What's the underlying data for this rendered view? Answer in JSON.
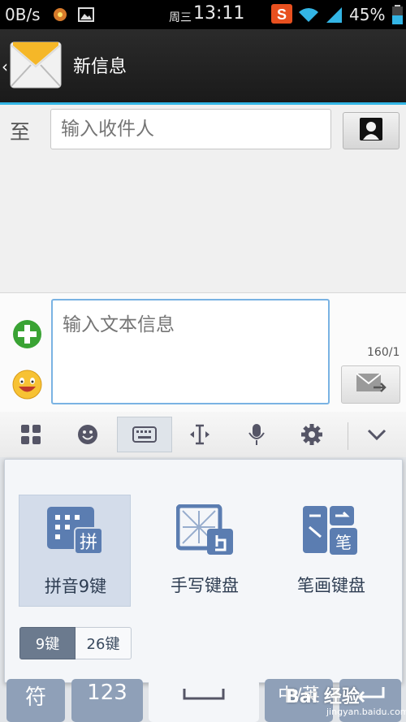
{
  "status_bar": {
    "net_speed": "0B/s",
    "weekday": "周三",
    "time": "13:11",
    "battery": "45%",
    "icons": [
      "gamepad-icon",
      "image-icon",
      "sogou-icon",
      "wifi-icon",
      "signal-icon",
      "battery-icon"
    ]
  },
  "header": {
    "title": "新信息",
    "app_icon": "envelope-icon"
  },
  "recipient": {
    "to_label": "至",
    "placeholder": "输入收件人"
  },
  "compose": {
    "placeholder": "输入文本信息",
    "char_counter": "160/1"
  },
  "ime_toolbar": {
    "items": [
      "grid-menu-icon",
      "emoji-icon",
      "keyboard-icon",
      "cursor-icon",
      "microphone-icon",
      "settings-icon",
      "collapse-chevron-icon"
    ],
    "selected": "keyboard-icon"
  },
  "keyboard_panel": {
    "options": [
      {
        "label": "拼音9键",
        "icon": "pinyin-9-icon",
        "selected": true,
        "badge": "拼"
      },
      {
        "label": "手写键盘",
        "icon": "handwriting-icon",
        "selected": false
      },
      {
        "label": "笔画键盘",
        "icon": "stroke-icon",
        "selected": false,
        "badge": "笔"
      }
    ],
    "layout_toggle": [
      {
        "label": "9键",
        "selected": true
      },
      {
        "label": "26键",
        "selected": false
      }
    ]
  },
  "bottom_keys": [
    "符",
    "123",
    "",
    "中/英"
  ],
  "watermark": {
    "text": "Bai 经验",
    "url": "jingyan.baidu.com"
  },
  "colors": {
    "accent": "#33b5e5",
    "selected_option": "#d3dcea",
    "key": "#8fa0b8"
  }
}
